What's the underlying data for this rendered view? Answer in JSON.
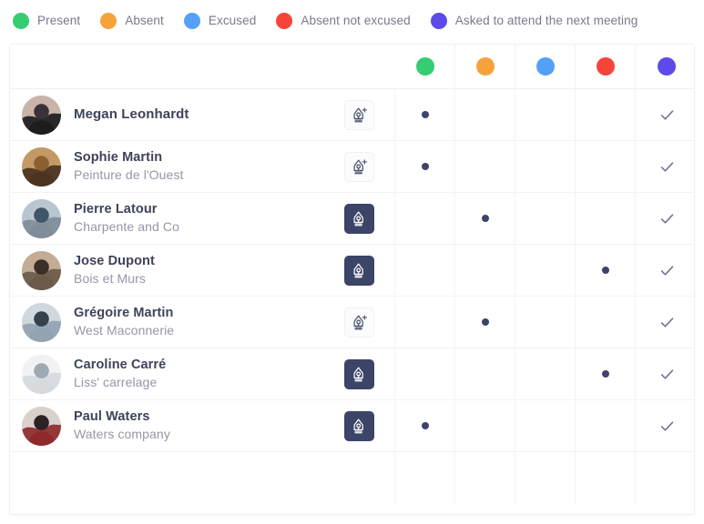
{
  "legend": {
    "items": [
      {
        "label": "Present",
        "color": "#35cd72"
      },
      {
        "label": "Absent",
        "color": "#f5a23d"
      },
      {
        "label": "Excused",
        "color": "#54a0f7"
      },
      {
        "label": "Absent not excused",
        "color": "#f7443b"
      },
      {
        "label": "Asked to attend the next meeting",
        "color": "#5d4ae8"
      }
    ]
  },
  "table": {
    "header": {
      "person_column_label": "",
      "document_column_label": "",
      "status_icons": [
        {
          "name": "status-present-dot",
          "color": "#35cd72",
          "label": "Present"
        },
        {
          "name": "status-absent-dot",
          "color": "#f5a23d",
          "label": "Absent"
        },
        {
          "name": "status-excused-dot",
          "color": "#54a0f7",
          "label": "Excused"
        },
        {
          "name": "status-absent-not-excused-dot",
          "color": "#f7443b",
          "label": "Absent not excused"
        },
        {
          "name": "status-asked-next-meeting-dot",
          "color": "#5d4ae8",
          "label": "Asked to attend the next meeting"
        }
      ]
    },
    "dot_color": "#3c4468",
    "check_color": "#6f768f",
    "rows": [
      {
        "name": "Megan Leonhardt",
        "company": "",
        "avatar": "avatar-megan-leonhardt",
        "document_icon": "pen-nib-add-icon",
        "document_state": "light",
        "marked_column": 0,
        "checked": true,
        "check_icon": "check-icon"
      },
      {
        "name": "Sophie Martin",
        "company": "Peinture de l'Ouest",
        "avatar": "avatar-sophie-martin",
        "document_icon": "pen-nib-add-icon",
        "document_state": "light",
        "marked_column": 0,
        "checked": true,
        "check_icon": "check-icon"
      },
      {
        "name": "Pierre Latour",
        "company": "Charpente and Co",
        "avatar": "avatar-pierre-latour",
        "document_icon": "pen-nib-icon",
        "document_state": "dark",
        "marked_column": 1,
        "checked": true,
        "check_icon": "check-icon"
      },
      {
        "name": "Jose Dupont",
        "company": "Bois et Murs",
        "avatar": "avatar-jose-dupont",
        "document_icon": "pen-nib-icon",
        "document_state": "dark",
        "marked_column": 3,
        "checked": true,
        "check_icon": "check-icon"
      },
      {
        "name": "Grégoire Martin",
        "company": "West Maconnerie",
        "avatar": "avatar-gregoire-martin",
        "document_icon": "pen-nib-add-icon",
        "document_state": "light",
        "marked_column": 1,
        "checked": true,
        "check_icon": "check-icon"
      },
      {
        "name": "Caroline  Carré",
        "company": "Liss' carrelage",
        "avatar": "avatar-caroline-carre",
        "document_icon": "pen-nib-icon",
        "document_state": "dark",
        "marked_column": 3,
        "checked": true,
        "check_icon": "check-icon"
      },
      {
        "name": "Paul Waters",
        "company": "Waters company",
        "avatar": "avatar-paul-waters",
        "document_icon": "pen-nib-icon",
        "document_state": "dark",
        "marked_column": 0,
        "checked": true,
        "check_icon": "check-icon"
      }
    ]
  }
}
